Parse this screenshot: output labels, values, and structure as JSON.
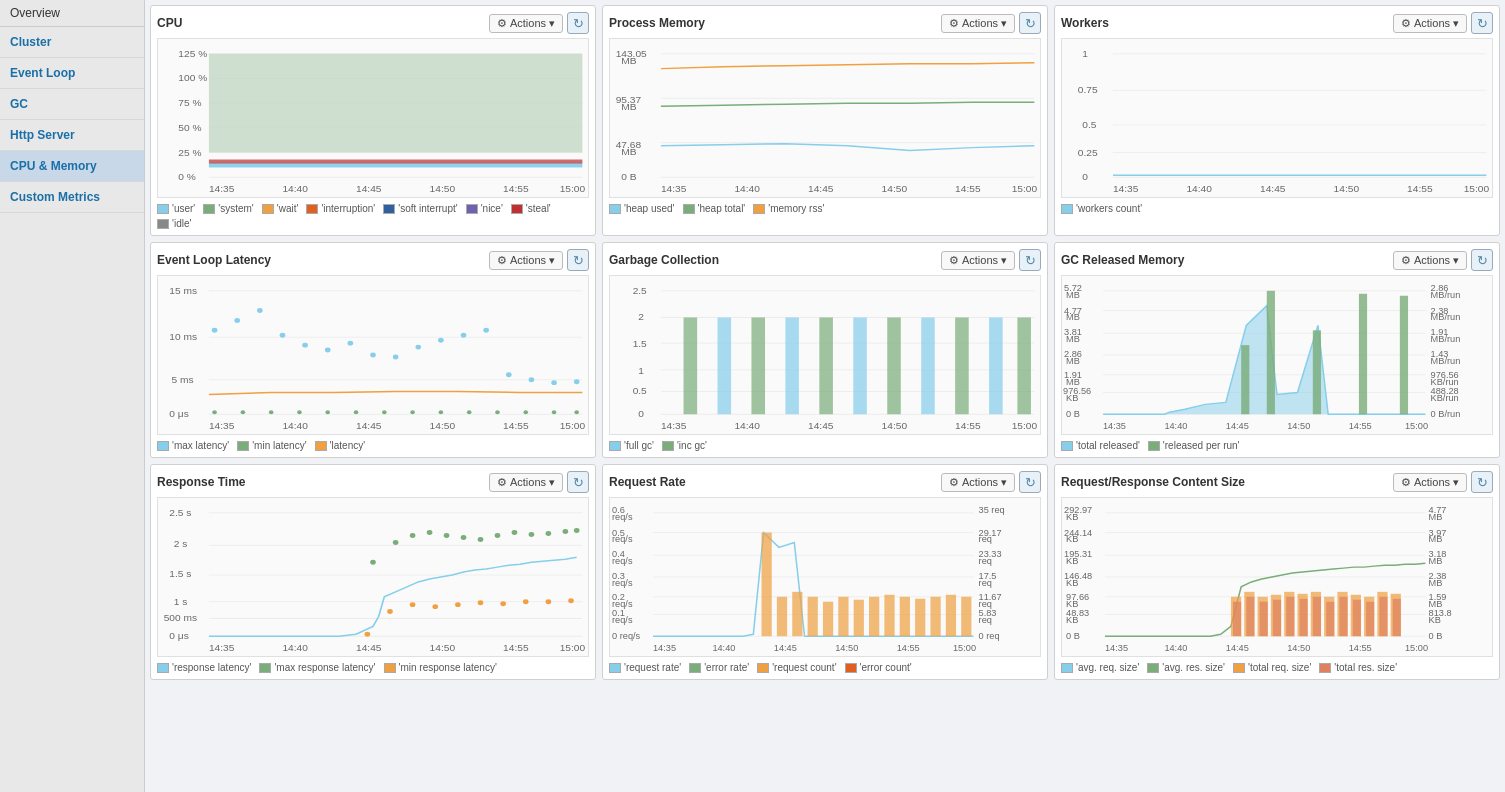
{
  "sidebar": {
    "overview_label": "Overview",
    "items": [
      {
        "label": "Cluster",
        "id": "cluster"
      },
      {
        "label": "Event Loop",
        "id": "event-loop"
      },
      {
        "label": "GC",
        "id": "gc"
      },
      {
        "label": "Http Server",
        "id": "http-server"
      },
      {
        "label": "CPU & Memory",
        "id": "cpu-memory",
        "active": true
      },
      {
        "label": "Custom Metrics",
        "id": "custom-metrics"
      }
    ]
  },
  "charts": {
    "actions_label": "Actions",
    "panels": [
      {
        "id": "cpu",
        "title": "CPU",
        "legend": [
          {
            "color": "#87ceeb",
            "label": "'user'"
          },
          {
            "color": "#7aad7a",
            "label": "'system'"
          },
          {
            "color": "#f0a040",
            "label": "'wait'"
          },
          {
            "color": "#e06020",
            "label": "'interruption'"
          },
          {
            "color": "#3060a0",
            "label": "'soft interrupt'"
          },
          {
            "color": "#7060b0",
            "label": "'nice'"
          },
          {
            "color": "#c03030",
            "label": "'steal'"
          },
          {
            "color": "#888888",
            "label": "'idle'"
          }
        ]
      },
      {
        "id": "process-memory",
        "title": "Process Memory",
        "legend": [
          {
            "color": "#87ceeb",
            "label": "'heap used'"
          },
          {
            "color": "#7aad7a",
            "label": "'heap total'"
          },
          {
            "color": "#f0a040",
            "label": "'memory rss'"
          }
        ]
      },
      {
        "id": "workers",
        "title": "Workers",
        "legend": [
          {
            "color": "#87ceeb",
            "label": "'workers count'"
          }
        ]
      },
      {
        "id": "event-loop-latency",
        "title": "Event Loop Latency",
        "legend": [
          {
            "color": "#87ceeb",
            "label": "'max latency'"
          },
          {
            "color": "#7aad7a",
            "label": "'min latency'"
          },
          {
            "color": "#f0a040",
            "label": "'latency'"
          }
        ]
      },
      {
        "id": "garbage-collection",
        "title": "Garbage Collection",
        "legend": [
          {
            "color": "#87ceeb",
            "label": "'full gc'"
          },
          {
            "color": "#7aad7a",
            "label": "'inc gc'"
          }
        ]
      },
      {
        "id": "gc-released-memory",
        "title": "GC Released Memory",
        "legend": [
          {
            "color": "#87ceeb",
            "label": "'total released'"
          },
          {
            "color": "#7aad7a",
            "label": "'released per run'"
          }
        ]
      },
      {
        "id": "response-time",
        "title": "Response Time",
        "legend": [
          {
            "color": "#87ceeb",
            "label": "'response latency'"
          },
          {
            "color": "#7aad7a",
            "label": "'max response latency'"
          },
          {
            "color": "#f0a040",
            "label": "'min response latency'"
          }
        ]
      },
      {
        "id": "request-rate",
        "title": "Request Rate",
        "legend": [
          {
            "color": "#87ceeb",
            "label": "'request rate'"
          },
          {
            "color": "#7aad7a",
            "label": "'error rate'"
          },
          {
            "color": "#f0a040",
            "label": "'request count'"
          },
          {
            "color": "#e06020",
            "label": "'error count'"
          }
        ]
      },
      {
        "id": "request-response-content-size",
        "title": "Request/Response Content Size",
        "legend": [
          {
            "color": "#87ceeb",
            "label": "'avg. req. size'"
          },
          {
            "color": "#7aad7a",
            "label": "'avg. res. size'"
          },
          {
            "color": "#f0a040",
            "label": "'total req. size'"
          },
          {
            "color": "#e06020",
            "label": "'total res. size'"
          }
        ]
      }
    ]
  }
}
